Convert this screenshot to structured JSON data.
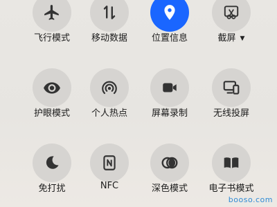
{
  "tiles": [
    {
      "label": "飞行模式",
      "icon": "airplane-icon",
      "active": false
    },
    {
      "label": "移动数据",
      "icon": "mobile-data-icon",
      "active": false
    },
    {
      "label": "位置信息",
      "icon": "location-pin-icon",
      "active": true
    },
    {
      "label": "截屏",
      "icon": "screenshot-scissors-icon",
      "active": false,
      "has_dropdown": true
    },
    {
      "label": "护眼模式",
      "icon": "eye-icon",
      "active": false
    },
    {
      "label": "个人热点",
      "icon": "hotspot-icon",
      "active": false
    },
    {
      "label": "屏幕录制",
      "icon": "video-camera-icon",
      "active": false
    },
    {
      "label": "无线投屏",
      "icon": "cast-screen-icon",
      "active": false
    },
    {
      "label": "免打扰",
      "icon": "moon-icon",
      "active": false
    },
    {
      "label": "NFC",
      "icon": "nfc-icon",
      "active": false
    },
    {
      "label": "深色模式",
      "icon": "dark-mode-icon",
      "active": false
    },
    {
      "label": "电子书模式",
      "icon": "book-icon",
      "active": false
    }
  ],
  "colors": {
    "active_accent": "#1a66ff",
    "tile_background": "#d6d4d1",
    "icon_color": "#333333",
    "watermark": "#2f8bd6"
  },
  "watermark": "booso.com"
}
